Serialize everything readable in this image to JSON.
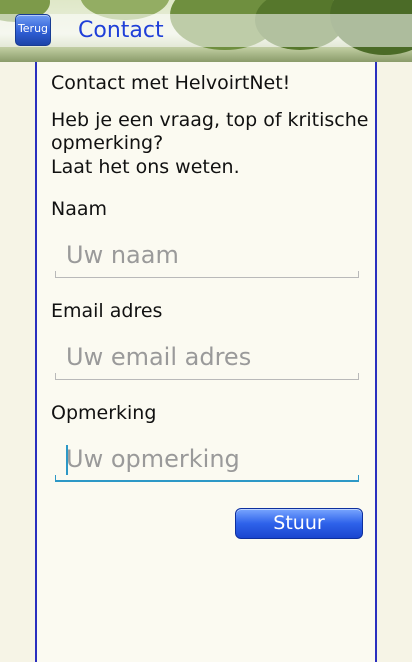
{
  "header": {
    "back_label": "Terug",
    "title": "Contact"
  },
  "intro": {
    "heading": "Contact met HelvoirtNet!",
    "line1": "Heb je een vraag, top of kritische",
    "line2": "opmerking?",
    "line3": "Laat het ons weten."
  },
  "form": {
    "name_label": "Naam",
    "name_placeholder": "Uw naam",
    "email_label": "Email adres",
    "email_placeholder": "Uw email adres",
    "remark_label": "Opmerking",
    "remark_placeholder": "Uw opmerking",
    "submit_label": "Stuur"
  },
  "colors": {
    "accent": "#1f3fd8",
    "button": "#2e62ea",
    "focus": "#2d98c6"
  }
}
